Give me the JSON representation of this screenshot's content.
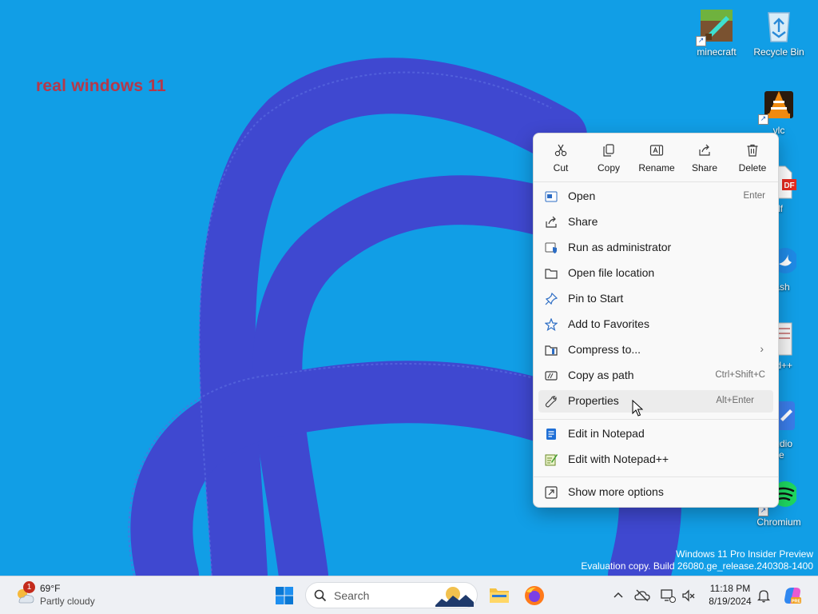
{
  "desktop": {
    "overlay_text": "real windows 11",
    "icons": [
      {
        "label": "minecraft"
      },
      {
        "label": "Recycle Bin"
      },
      {
        "label": "vlc"
      },
      {
        "label": "df"
      },
      {
        "label": "Bash"
      },
      {
        "label": "pad++"
      },
      {
        "label": "Studio"
      },
      {
        "label": "de"
      },
      {
        "label": "Chromium"
      }
    ],
    "watermark": {
      "line1": "Windows 11 Pro Insider Preview",
      "line2": "Evaluation copy. Build 26080.ge_release.240308-1400"
    }
  },
  "context_menu": {
    "toolbar": [
      {
        "label": "Cut",
        "icon": "scissors-icon"
      },
      {
        "label": "Copy",
        "icon": "copy-icon"
      },
      {
        "label": "Rename",
        "icon": "rename-icon"
      },
      {
        "label": "Share",
        "icon": "share-icon"
      },
      {
        "label": "Delete",
        "icon": "trash-icon"
      }
    ],
    "items": [
      {
        "label": "Open",
        "shortcut": "Enter",
        "icon": "open-icon"
      },
      {
        "label": "Share",
        "shortcut": "",
        "icon": "share-icon"
      },
      {
        "label": "Run as administrator",
        "shortcut": "",
        "icon": "shield-icon"
      },
      {
        "label": "Open file location",
        "shortcut": "",
        "icon": "folder-icon"
      },
      {
        "label": "Pin to Start",
        "shortcut": "",
        "icon": "pin-icon"
      },
      {
        "label": "Add to Favorites",
        "shortcut": "",
        "icon": "star-icon"
      },
      {
        "label": "Compress to...",
        "shortcut": "",
        "icon": "zip-icon"
      },
      {
        "label": "Copy as path",
        "shortcut": "Ctrl+Shift+C",
        "icon": "path-icon"
      },
      {
        "label": "Properties",
        "shortcut": "Alt+Enter",
        "icon": "wrench-icon"
      },
      {
        "label": "Edit in Notepad",
        "shortcut": "",
        "icon": "notepad-icon"
      },
      {
        "label": "Edit with Notepad++",
        "shortcut": "",
        "icon": "notepadpp-icon"
      },
      {
        "label": "Show more options",
        "shortcut": "",
        "icon": "more-options-icon"
      }
    ]
  },
  "taskbar": {
    "weather": {
      "badge": "1",
      "temp": "69°F",
      "condition": "Partly cloudy"
    },
    "search": {
      "placeholder": "Search"
    },
    "clock": {
      "time": "11:18 PM",
      "date": "8/19/2024"
    }
  },
  "colors": {
    "desktop_bg": "#119ee6",
    "wallpaper_shape": "#4348d2",
    "overlay_text": "#b5384a",
    "menu_bg": "#f9f9f9",
    "taskbar_bg": "#eef0f4",
    "accent": "#0067c0"
  }
}
